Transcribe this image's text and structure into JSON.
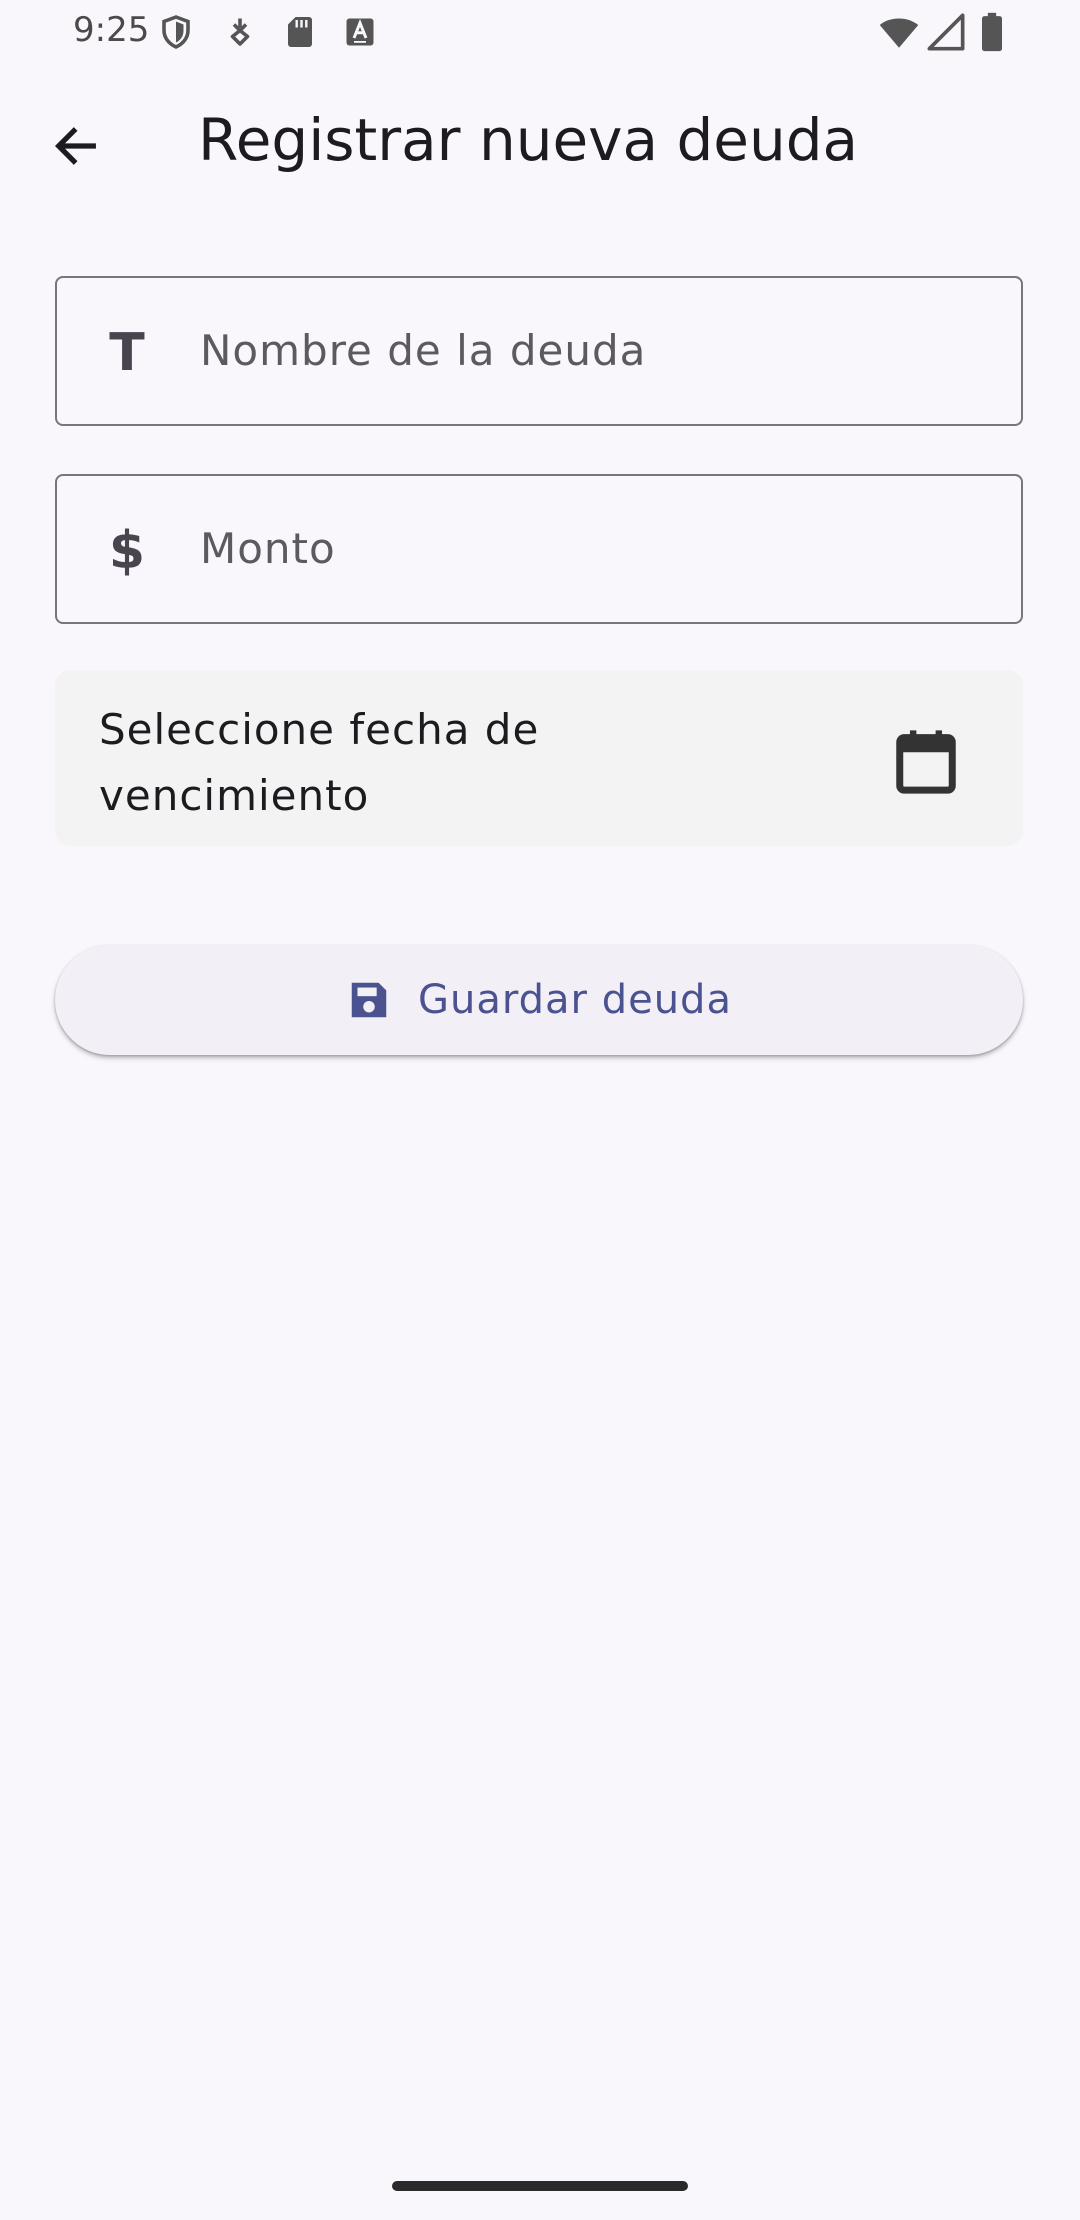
{
  "status_bar": {
    "time": "9:25",
    "icons": [
      "shield-icon",
      "usb-debug-icon",
      "sd-card-icon",
      "accessibility-a-icon",
      "wifi-icon",
      "signal-icon",
      "battery-icon"
    ]
  },
  "app_bar": {
    "back_icon": "arrow-back-icon",
    "title": "Registrar nueva deuda"
  },
  "form": {
    "name_field": {
      "icon": "text-T-icon",
      "icon_glyph": "T",
      "placeholder": "Nombre de la deuda",
      "value": ""
    },
    "amount_field": {
      "icon": "dollar-icon",
      "icon_glyph": "$",
      "placeholder": "Monto",
      "value": ""
    },
    "date_picker": {
      "label": "Seleccione fecha de vencimiento",
      "icon": "calendar-icon"
    },
    "save_button": {
      "icon": "save-icon",
      "label": "Guardar deuda"
    }
  },
  "colors": {
    "background": "#f9f6fc",
    "accent": "#4b5290",
    "outline": "#79747e",
    "date_bg": "#f3f3f3",
    "button_bg": "#f3eff6"
  }
}
